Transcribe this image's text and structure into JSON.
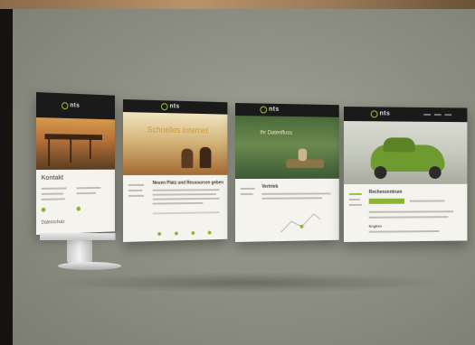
{
  "background": {
    "stage_color": "#8f9185",
    "accent_green": "#8fb238"
  },
  "screens": [
    {
      "logo": "nts",
      "hero_text": "",
      "heading": "Kontakt",
      "sub_heading": "Datenschutz"
    },
    {
      "logo": "nts",
      "hero_text": "Schnelles Internet",
      "heading": "Neuen Platz und Ressourcen geben",
      "sub_heading": ""
    },
    {
      "logo": "nts",
      "hero_text": "Ihr Datenfluss",
      "heading": "Vertrieb",
      "sub_heading": ""
    },
    {
      "logo": "nts",
      "hero_text": "",
      "heading": "Rechenzentrum",
      "sub_heading": "English"
    }
  ]
}
